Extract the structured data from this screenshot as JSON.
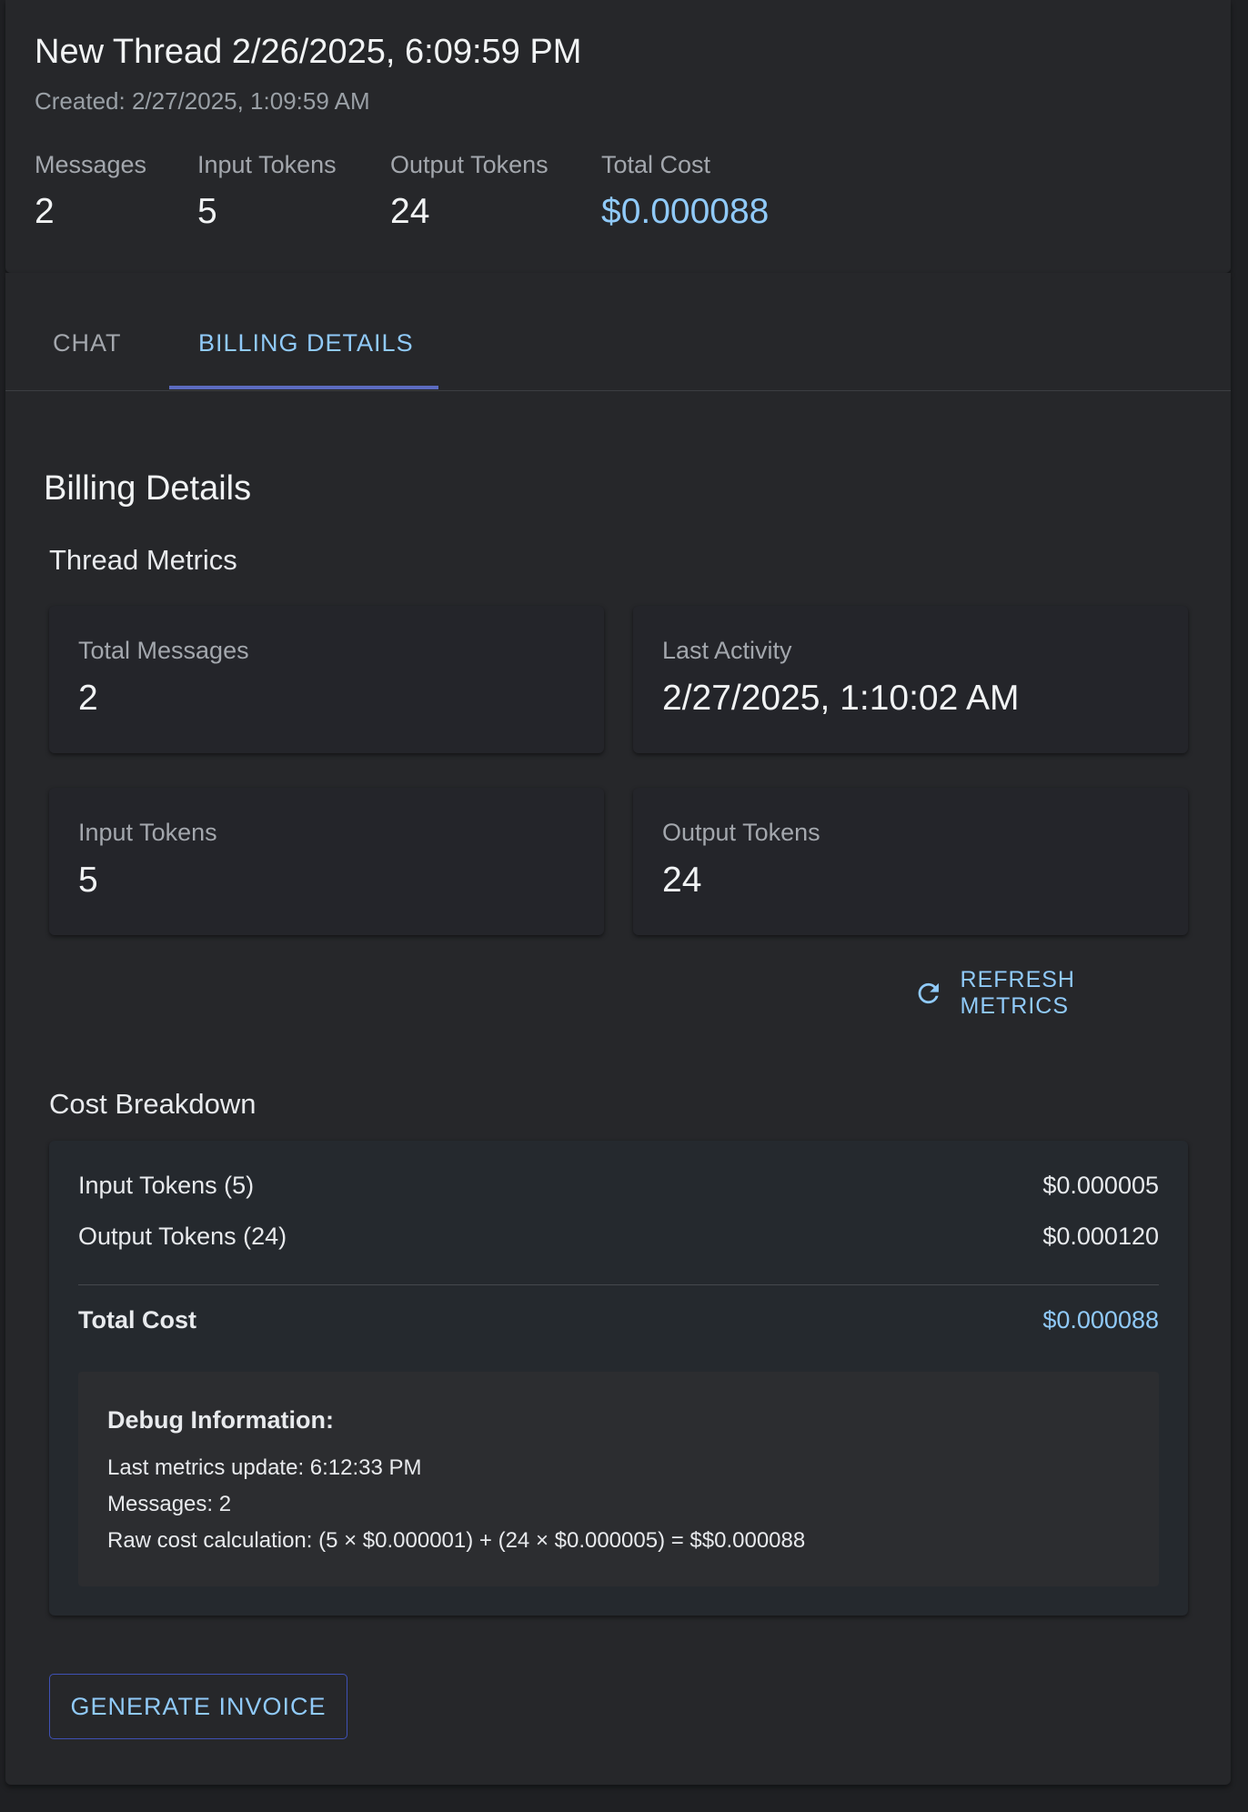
{
  "header": {
    "title": "New Thread 2/26/2025, 6:09:59 PM",
    "created": "Created: 2/27/2025, 1:09:59 AM",
    "stats": [
      {
        "label": "Messages",
        "value": "2"
      },
      {
        "label": "Input Tokens",
        "value": "5"
      },
      {
        "label": "Output Tokens",
        "value": "24"
      },
      {
        "label": "Total Cost",
        "value": "$0.000088"
      }
    ]
  },
  "tabs": [
    {
      "label": "CHAT"
    },
    {
      "label": "BILLING DETAILS",
      "active": true
    }
  ],
  "billing": {
    "title": "Billing Details",
    "metrics_heading": "Thread Metrics",
    "metrics": [
      {
        "label": "Total Messages",
        "value": "2"
      },
      {
        "label": "Last Activity",
        "value": "2/27/2025, 1:10:02 AM"
      },
      {
        "label": "Input Tokens",
        "value": "5"
      },
      {
        "label": "Output Tokens",
        "value": "24"
      }
    ],
    "refresh_label": "REFRESH METRICS",
    "breakdown_heading": "Cost Breakdown",
    "breakdown": {
      "rows": [
        {
          "label": "Input Tokens (5)",
          "amount": "$0.000005"
        },
        {
          "label": "Output Tokens (24)",
          "amount": "$0.000120"
        }
      ],
      "total": {
        "label": "Total Cost",
        "amount": "$0.000088"
      }
    },
    "debug": {
      "title": "Debug Information:",
      "lines": [
        "Last metrics update: 6:12:33 PM",
        "Messages: 2",
        "Raw cost calculation: (5 × $0.000001) + (24 × $0.000005) = $$0.000088"
      ]
    },
    "invoice_label": "GENERATE INVOICE"
  },
  "colors": {
    "background": "#1f2023",
    "card": "#26272a",
    "accent": "#90caf9",
    "tab_indicator": "#5c6bc0",
    "button_border": "#3f51b5"
  }
}
